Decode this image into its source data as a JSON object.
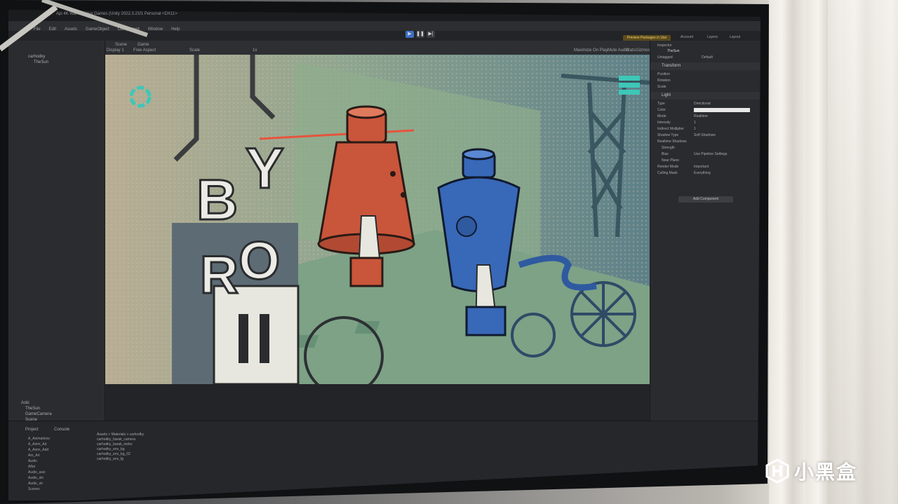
{
  "editor": {
    "window_title": "Api 4K Wai Ki Linux Games (Unity 2022.3.21f1 Personal <DX11>",
    "menu": [
      "File",
      "Edit",
      "Assets",
      "GameObject",
      "Component",
      "Window",
      "Help"
    ],
    "preview_badge": "Preview Packages in Use",
    "top_right": [
      "Account",
      "Layers",
      "Layout"
    ],
    "hierarchy": {
      "scene": "carhodky",
      "items": [
        "TheSun"
      ],
      "bottom_items": [
        "Asbi",
        "TheSun",
        "GameCamera",
        "Scene"
      ]
    },
    "game_tabs": [
      "Scene",
      "Game"
    ],
    "game_options": [
      "Display 1",
      "Free Aspect",
      "Scale",
      "1x",
      "Maximize On Play",
      "Mute Audio",
      "Stats",
      "Gizmos"
    ],
    "inspector": {
      "title": "Inspector",
      "object": "TheSun",
      "tag": "Untagged",
      "layer": "Default",
      "transform": {
        "label": "Transform",
        "rows": [
          "Position",
          "Rotation",
          "Scale"
        ]
      },
      "light": {
        "label": "Light",
        "rows": [
          "Type",
          "Color",
          "Mode",
          "Intensity",
          "Indirect Multiplier",
          "Shadow Type",
          "Realtime Shadows",
          "Strength",
          "Bias",
          "Near Plane",
          "Render Mode",
          "Culling Mask"
        ],
        "values": [
          "Directional",
          "",
          "Realtime",
          "1",
          "1",
          "Soft Shadows",
          "",
          "",
          "Use Pipeline Settings",
          "",
          "Important",
          "Everything"
        ]
      },
      "add_component": "Add Component"
    },
    "project": {
      "tabs": [
        "Project",
        "Console"
      ],
      "breadcrumb": "Assets > Materials > carhodky",
      "tree": [
        "A_Animations",
        "A_Anim_Ad",
        "A_Anim_Add",
        "Am_Art",
        "Audio",
        "Aflat",
        "Audio_assi",
        "Audio_sfx",
        "Audio_str",
        "Scenes"
      ],
      "files": [
        "carhodky_barak_camera",
        "carhodky_barak_mobv",
        "carhodky_env_bg",
        "carhodky_env_bg_02",
        "carhodky_env_fg"
      ]
    }
  },
  "game_art": {
    "sign_letters": [
      "B",
      "Y",
      "R",
      "O"
    ],
    "colors": {
      "red_tower": "#c9553b",
      "blue_tower": "#3868b8",
      "bg_green": "#7f9a84",
      "teal": "#3ec7b8"
    }
  },
  "watermark": {
    "text": "小黑盒"
  }
}
